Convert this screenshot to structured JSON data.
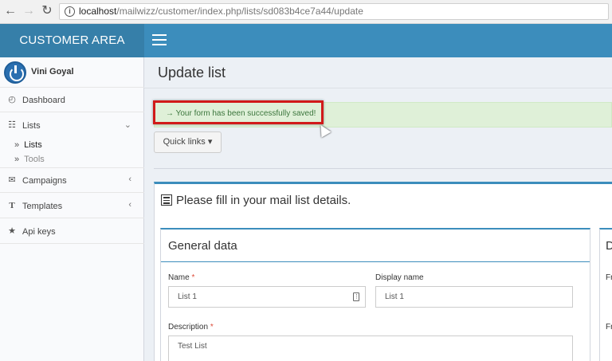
{
  "browser": {
    "url_host": "localhost",
    "url_path": "/mailwizz/customer/index.php/lists/sd083b4ce7a44/update",
    "back_icon": "arrow-left-icon",
    "forward_icon": "arrow-right-icon",
    "reload_icon": "reload-icon",
    "info_icon": "info-icon"
  },
  "header": {
    "brand": "CUSTOMER AREA",
    "menu_icon": "hamburger-icon",
    "colors": {
      "brand_bg": "#367fa9",
      "nav_bg": "#3c8dbc"
    }
  },
  "sidebar": {
    "user": "Vini Goyal",
    "items": [
      {
        "label": "Dashboard",
        "icon": "dashboard-icon"
      },
      {
        "label": "Lists",
        "icon": "list-icon"
      },
      {
        "label": "Campaigns",
        "icon": "envelope-icon"
      },
      {
        "label": "Templates",
        "icon": "text-icon"
      },
      {
        "label": "Api keys",
        "icon": "star-icon"
      }
    ],
    "sub_items": [
      {
        "label": "Lists"
      },
      {
        "label": "Tools"
      }
    ]
  },
  "main": {
    "page_title": "Update list",
    "alert": "→ Your form has been successfully saved!",
    "quick_links": "Quick links ▾",
    "box_title": "Please fill in your mail list details.",
    "general": {
      "title": "General data",
      "name_label": "Name",
      "name_value": "List 1",
      "display_label": "Display name",
      "display_value": "List 1",
      "desc_label": "Description",
      "desc_value": "Test List",
      "required_mark": "*"
    },
    "right_box": {
      "title_char": "D",
      "f1": "Fr",
      "f2": "Fr"
    }
  }
}
